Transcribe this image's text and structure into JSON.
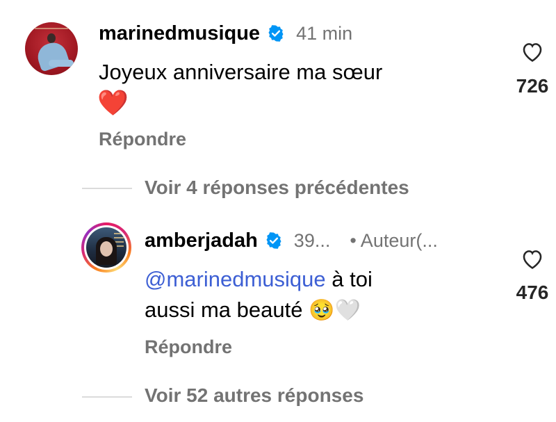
{
  "comment1": {
    "username": "marinedmusique",
    "time": "41 min",
    "text_line1": "Joyeux anniversaire ma sœur",
    "emoji": "❤️",
    "reply_label": "Répondre",
    "like_count": "726"
  },
  "view_previous": {
    "label": "Voir 4 réponses précédentes"
  },
  "comment2": {
    "username": "amberjadah",
    "time": "39...",
    "author_badge": "• Auteur(...",
    "mention": "@marinedmusique",
    "text_after_mention": " à toi",
    "text_line2": "aussi ma beauté",
    "emojis": "🥹🤍",
    "reply_label": "Répondre",
    "like_count": "476"
  },
  "view_more": {
    "label": "Voir 52 autres réponses"
  },
  "colors": {
    "verified_blue": "#0095f6",
    "secondary_text": "#737373",
    "mention": "#3d5fd4"
  }
}
